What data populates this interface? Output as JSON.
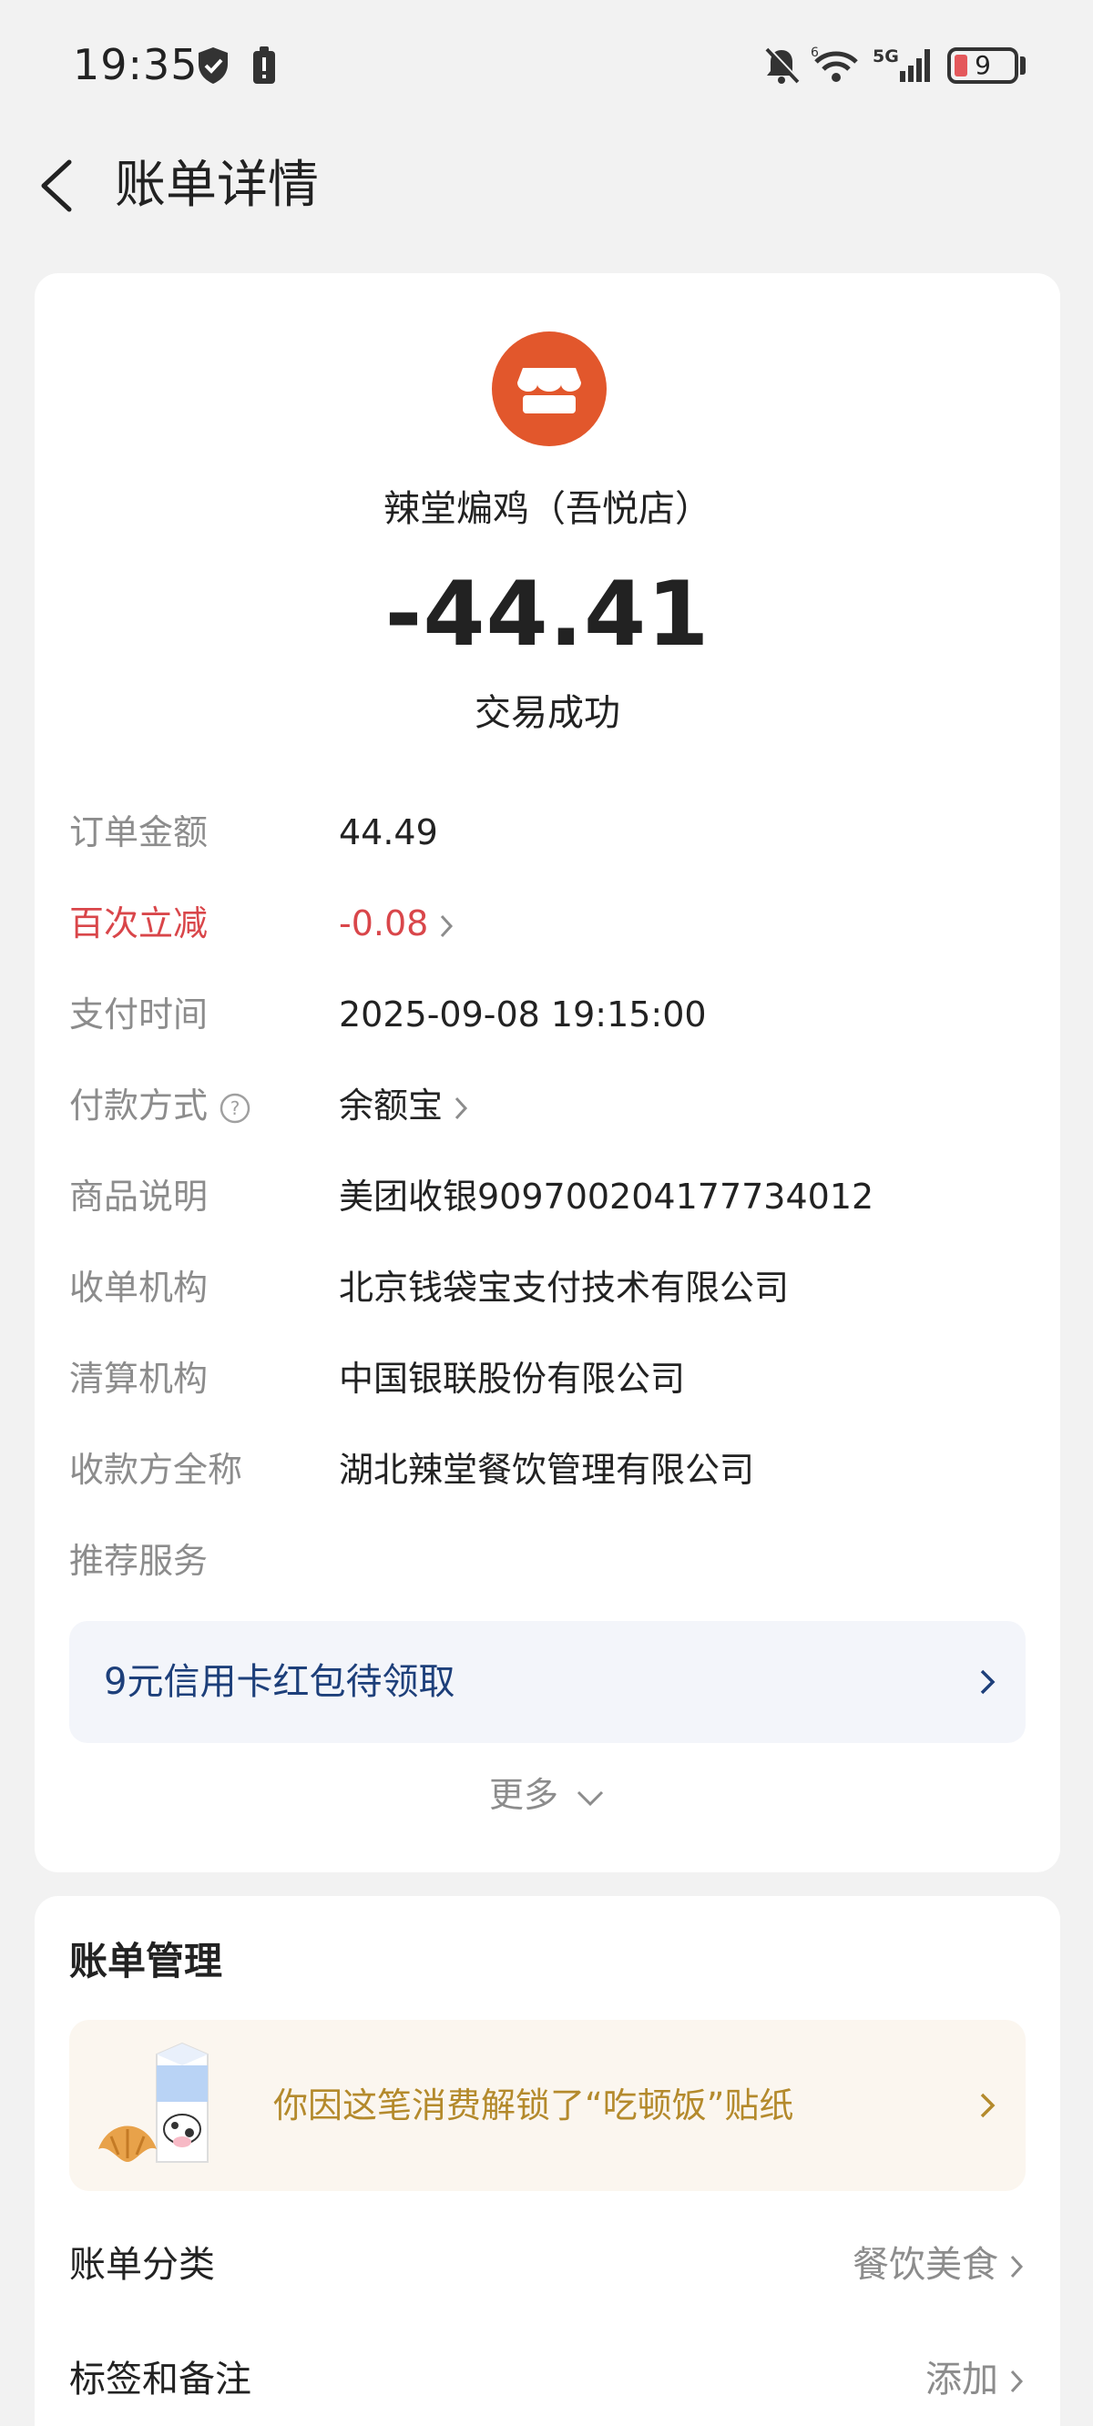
{
  "status_bar": {
    "time": "19:35",
    "battery_level": "9",
    "network": "5G",
    "icons": [
      "shield-icon",
      "battery-alert-icon",
      "bell-off-icon",
      "wifi-icon",
      "signal-icon",
      "battery-icon"
    ]
  },
  "header": {
    "title": "账单详情",
    "back_icon": "back-arrow-icon"
  },
  "summary": {
    "merchant_icon": "store-icon",
    "merchant_icon_color": "#e2572c",
    "merchant_name": "辣堂煸鸡（吾悦店）",
    "amount": "-44.41",
    "status": "交易成功"
  },
  "details": [
    {
      "label": "订单金额",
      "value": "44.49"
    },
    {
      "label": "百次立减",
      "value": "-0.08",
      "highlight_color": "#d9464a"
    },
    {
      "label": "支付时间",
      "value": "2025-09-08 19:15:00"
    },
    {
      "label": "付款方式",
      "value": "余额宝"
    },
    {
      "label": "商品说明",
      "value": "美团收银909700204177734012"
    },
    {
      "label": "收单机构",
      "value": "北京钱袋宝支付技术有限公司"
    },
    {
      "label": "清算机构",
      "value": "中国银联股份有限公司"
    },
    {
      "label": "收款方全称",
      "value": "湖北辣堂餐饮管理有限公司"
    },
    {
      "label": "推荐服务",
      "value": ""
    }
  ],
  "promo": {
    "text": "9元信用卡红包待领取"
  },
  "more_label": "更多",
  "manage": {
    "title": "账单管理",
    "sticker_text": "你因这笔消费解锁了“吃顿饭”贴纸",
    "rows": [
      {
        "label": "账单分类",
        "value": "餐饮美食"
      },
      {
        "label": "标签和备注",
        "value": "添加"
      }
    ]
  }
}
